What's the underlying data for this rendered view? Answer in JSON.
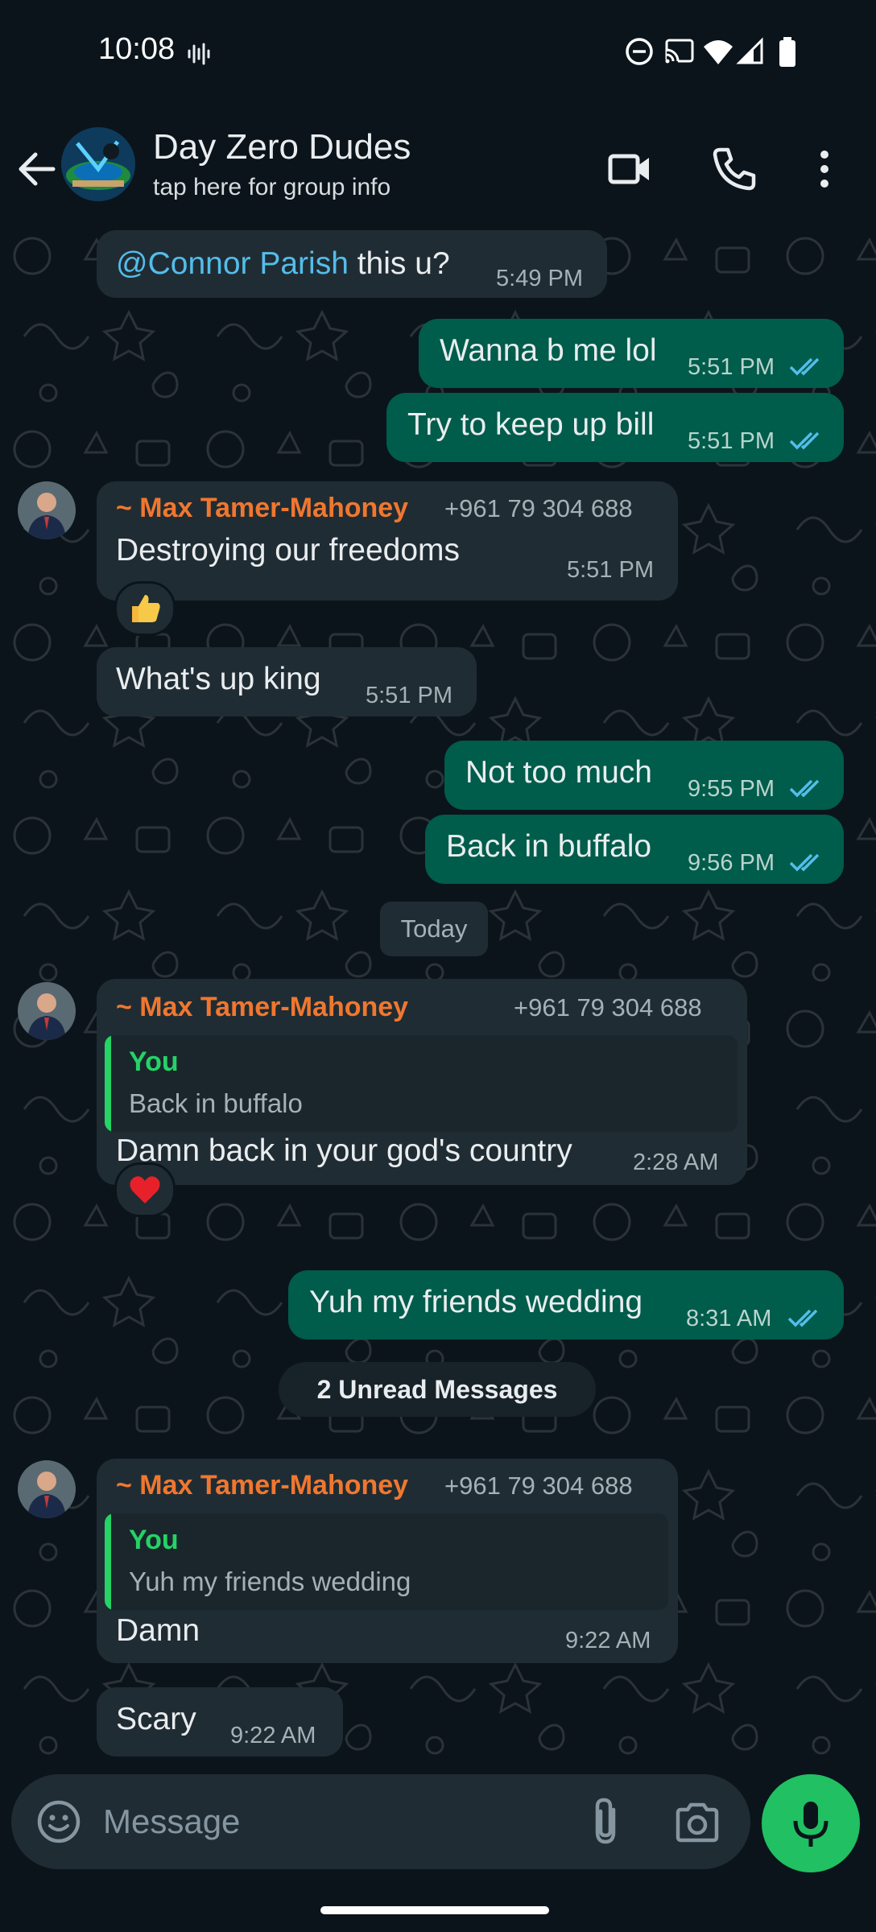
{
  "status_bar": {
    "time": "10:08"
  },
  "header": {
    "group_name": "Day Zero Dudes",
    "subtitle": "tap here for group info",
    "icons": [
      "back-arrow-icon",
      "video-call-icon",
      "phone-icon",
      "more-vert-icon"
    ]
  },
  "colors": {
    "outgoing": "#005c4b",
    "incoming": "#202c33",
    "sender": "#f0772f",
    "accent": "#21c063",
    "read_ticks": "#53bdeb"
  },
  "messages": {
    "m1": {
      "mention": "@Connor Parish",
      "text": " this u?",
      "time": "5:49 PM"
    },
    "m2": {
      "text": "Wanna b me lol",
      "time": "5:51 PM"
    },
    "m3": {
      "text": "Try to keep up bill",
      "time": "5:51 PM"
    },
    "m4": {
      "sender": "~ Max Tamer-Mahoney",
      "phone": "+961 79 304 688",
      "text": "Destroying our freedoms",
      "time": "5:51 PM",
      "reaction": "thumbs-up"
    },
    "m5": {
      "text": "What's up king",
      "time": "5:51 PM"
    },
    "m6": {
      "text": "Not too much",
      "time": "9:55 PM"
    },
    "m7": {
      "text": "Back in buffalo",
      "time": "9:56 PM"
    },
    "date_chip": "Today",
    "m8": {
      "sender": "~ Max Tamer-Mahoney",
      "phone": "+961 79 304 688",
      "quote_name": "You",
      "quote_text": "Back in buffalo",
      "text": "Damn back in your god's country",
      "time": "2:28 AM",
      "reaction": "heart"
    },
    "m9": {
      "text": "Yuh my friends wedding",
      "time": "8:31 AM"
    },
    "unread_chip": "2 Unread Messages",
    "m10": {
      "sender": "~ Max Tamer-Mahoney",
      "phone": "+961 79 304 688",
      "quote_name": "You",
      "quote_text": "Yuh my friends wedding",
      "text": "Damn",
      "time": "9:22 AM"
    },
    "m11": {
      "text": "Scary",
      "time": "9:22 AM"
    }
  },
  "composer": {
    "placeholder": "Message"
  }
}
